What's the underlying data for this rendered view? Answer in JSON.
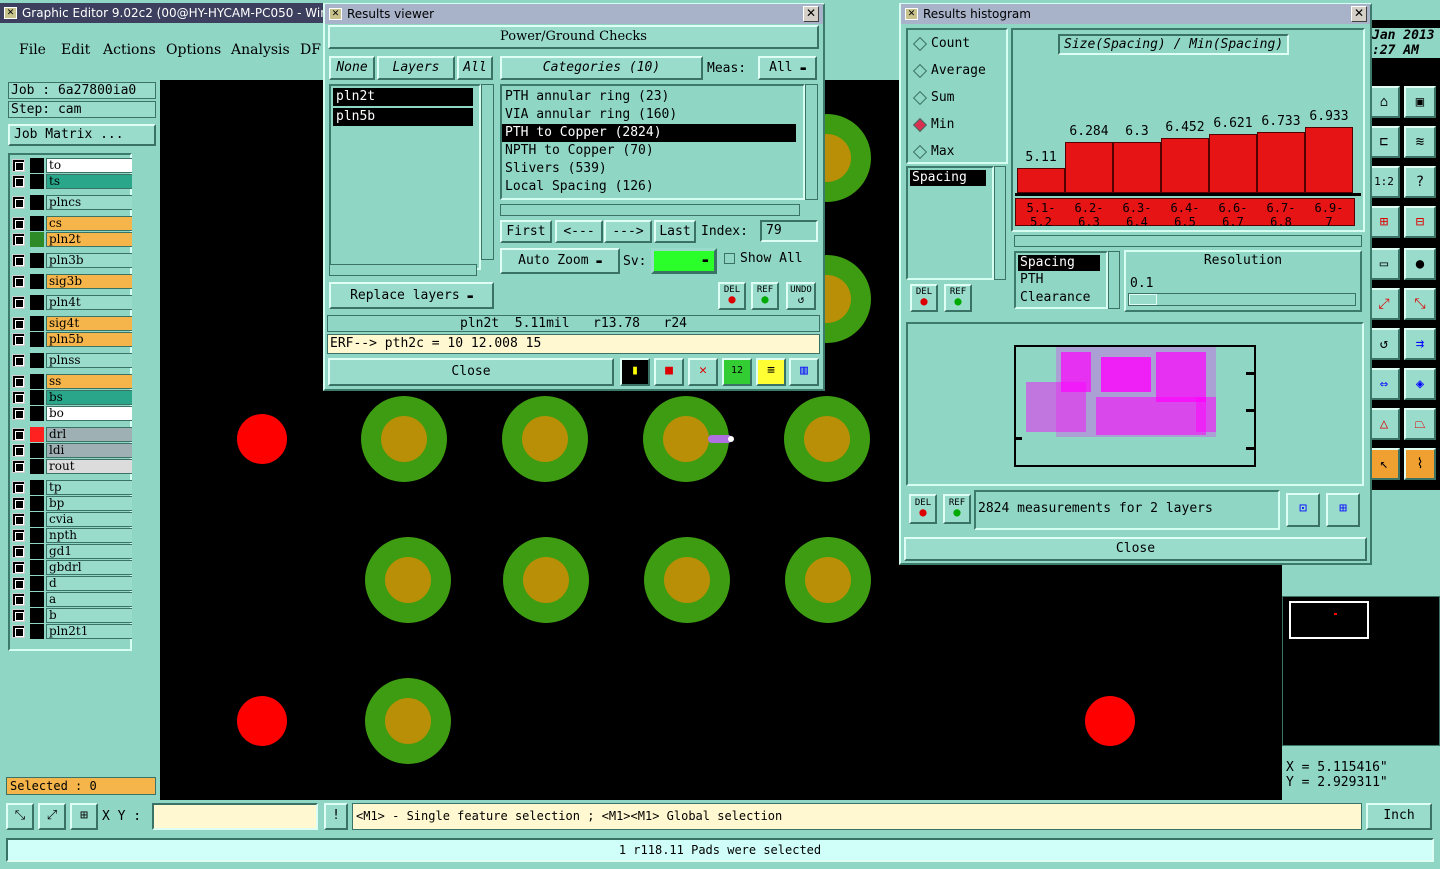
{
  "main_window": {
    "title": "Graphic Editor 9.02c2 (00@HY-HYCAM-PC050 - Windo",
    "menu": [
      "File",
      "Edit",
      "Actions",
      "Options",
      "Analysis",
      "DF"
    ],
    "job_label": "Job : 6a27800ia0",
    "step_label": "Step: cam",
    "job_matrix": "Job Matrix ...",
    "layers": [
      {
        "name": "to",
        "color": "#ffffff",
        "sw": "#000000"
      },
      {
        "name": "ts",
        "color": "#2aa78a",
        "sw": "#000000"
      },
      {
        "name": "plncs",
        "color": "#9adccc",
        "sw": "#000000"
      },
      {
        "name": "cs",
        "color": "#f5b54a",
        "sw": "#000000"
      },
      {
        "name": "pln2t",
        "color": "#f5b54a",
        "sw": "#2e8a26"
      },
      {
        "name": "pln3b",
        "color": "#9adccc",
        "sw": "#000000"
      },
      {
        "name": "sig3b",
        "color": "#f5b54a",
        "sw": "#000000"
      },
      {
        "name": "pln4t",
        "color": "#9adccc",
        "sw": "#000000"
      },
      {
        "name": "sig4t",
        "color": "#f5b54a",
        "sw": "#000000"
      },
      {
        "name": "pln5b",
        "color": "#f5b54a",
        "sw": "#000000"
      },
      {
        "name": "plnss",
        "color": "#9adccc",
        "sw": "#000000"
      },
      {
        "name": "ss",
        "color": "#f5b54a",
        "sw": "#000000"
      },
      {
        "name": "bs",
        "color": "#2aa78a",
        "sw": "#000000"
      },
      {
        "name": "bo",
        "color": "#ffffff",
        "sw": "#000000"
      },
      {
        "name": "drl",
        "color": "#9fb0b4",
        "sw": "#ff2020"
      },
      {
        "name": "ldi",
        "color": "#9fb0b4",
        "sw": "#000000"
      },
      {
        "name": "rout",
        "color": "#dcdcdc",
        "sw": "#000000"
      },
      {
        "name": "tp",
        "color": "#9adccc",
        "sw": "#000000"
      },
      {
        "name": "bp",
        "color": "#9adccc",
        "sw": "#000000"
      },
      {
        "name": "cvia",
        "color": "#9adccc",
        "sw": "#000000"
      },
      {
        "name": "npth",
        "color": "#9adccc",
        "sw": "#000000"
      },
      {
        "name": "gd1",
        "color": "#9adccc",
        "sw": "#000000"
      },
      {
        "name": "gbdrl",
        "color": "#9adccc",
        "sw": "#000000"
      },
      {
        "name": "d",
        "color": "#9adccc",
        "sw": "#000000"
      },
      {
        "name": "a",
        "color": "#9adccc",
        "sw": "#000000"
      },
      {
        "name": "b",
        "color": "#9adccc",
        "sw": "#000000"
      },
      {
        "name": "pln2t1",
        "color": "#9adccc",
        "sw": "#000000"
      }
    ],
    "selected_label": "Selected : 0",
    "xy_label": "X Y :",
    "hint": "<M1> - Single feature selection ; <M1><M1> Global selection",
    "units": "Inch",
    "status": "1 r118.11 Pads were selected",
    "clock_line1": "Jan 2013",
    "clock_line2": ":27 AM",
    "coord_x": "X = 5.115416\"",
    "coord_y": "Y = 2.929311\""
  },
  "results_viewer": {
    "title": "Results viewer",
    "header": "Power/Ground Checks",
    "btn_none": "None",
    "btn_layers": "Layers",
    "btn_all": "All",
    "layer_list": [
      "pln2t",
      "pln5b"
    ],
    "categories_btn": "Categories (10)",
    "meas_label": "Meas:",
    "meas_value": "All",
    "categories": [
      "PTH annular ring (23)",
      "VIA annular ring (160)",
      "PTH to Copper (2824)",
      "NPTH to Copper (70)",
      "Slivers (539)",
      "Local Spacing (126)"
    ],
    "btn_first": "First",
    "btn_prev": "<---",
    "btn_next": "--->",
    "btn_last": "Last",
    "index_label": "Index:",
    "index_value": "79",
    "auto_zoom": "Auto Zoom",
    "sv_label": "Sv:",
    "show_all": "Show All",
    "replace_layers": "Replace layers",
    "del": "DEL",
    "ref": "REF",
    "undo": "UNDO",
    "info_line": "pln2t  5.11mil   r13.78   r24",
    "erf_line": "ERF--> pth2c = 10 12.008 15",
    "close": "Close"
  },
  "histogram": {
    "title": "Results histogram",
    "options": [
      "Count",
      "Average",
      "Sum",
      "Min",
      "Max"
    ],
    "selected_option": "Min",
    "list_item": "Spacing",
    "chart_title": "Size(Spacing) / Min(Spacing)",
    "value_labels": [
      "5.11",
      "6.284",
      "6.3",
      "6.452",
      "6.621",
      "6.733",
      "6.933"
    ],
    "bin_labels": [
      [
        "5.1-",
        "5.2"
      ],
      [
        "6.2-",
        "6.3"
      ],
      [
        "6.3-",
        "6.4"
      ],
      [
        "6.4-",
        "6.5"
      ],
      [
        "6.6-",
        "6.7"
      ],
      [
        "6.7-",
        "6.8"
      ],
      [
        "6.9-",
        "7"
      ]
    ],
    "types": [
      "Spacing",
      "PTH",
      "Clearance"
    ],
    "resolution_label": "Resolution",
    "resolution_value": "0.1",
    "del": "DEL",
    "ref": "REF",
    "measurements": "2824 measurements for 2 layers",
    "close": "Close"
  }
}
